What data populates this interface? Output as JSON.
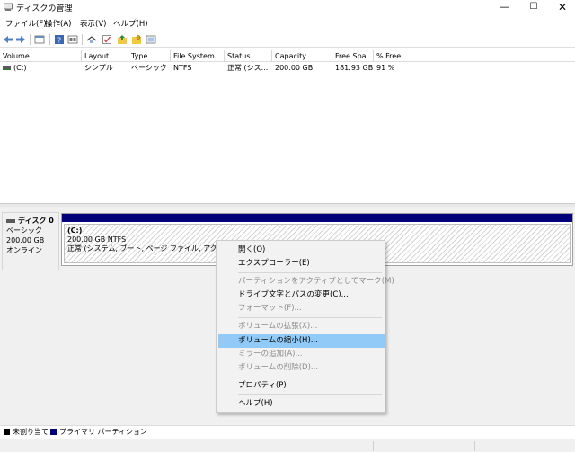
{
  "window": {
    "title": "ディスクの管理",
    "min": "—",
    "max": "☐",
    "close": "✕"
  },
  "menu": [
    "ファイル(F)",
    "操作(A)",
    "表示(V)",
    "ヘルプ(H)"
  ],
  "toolbar_icons": [
    "back-arrow-icon",
    "forward-arrow-icon",
    "disk-list-icon",
    "help-icon",
    "properties-icon",
    "connect-icon",
    "check-icon",
    "up-folder-icon",
    "folder-key-icon",
    "view-icon"
  ],
  "columns": [
    "Volume",
    "Layout",
    "Type",
    "File System",
    "Status",
    "Capacity",
    "Free Spa...",
    "% Free"
  ],
  "rows": [
    {
      "volume": "(C:)",
      "layout": "シンプル",
      "type": "ベーシック",
      "fs": "NTFS",
      "status": "正常 (シス...",
      "capacity": "200.00 GB",
      "free": "181.93 GB",
      "pct": "91 %"
    }
  ],
  "disk": {
    "name": "ディスク 0",
    "type": "ベーシック",
    "size": "200.00 GB",
    "state": "オンライン"
  },
  "partition": {
    "name": "(C:)",
    "size_fs": "200.00 GB NTFS",
    "status": "正常 (システム, ブート, ページ ファイル, アクティブ, クラ"
  },
  "context_menu": [
    {
      "label": "開く(O)",
      "enabled": true
    },
    {
      "label": "エクスプローラー(E)",
      "enabled": true
    },
    {
      "label": "パーティションをアクティブとしてマーク(M)",
      "enabled": false
    },
    {
      "label": "ドライブ文字とパスの変更(C)...",
      "enabled": true
    },
    {
      "label": "フォーマット(F)...",
      "enabled": false
    },
    {
      "label": "ボリュームの拡張(X)...",
      "enabled": false
    },
    {
      "label": "ボリュームの縮小(H)...",
      "enabled": true,
      "highlighted": true
    },
    {
      "label": "ミラーの追加(A)...",
      "enabled": false
    },
    {
      "label": "ボリュームの削除(D)...",
      "enabled": false
    },
    {
      "label": "プロパティ(P)",
      "enabled": true
    },
    {
      "label": "ヘルプ(H)",
      "enabled": true
    }
  ],
  "legend": [
    {
      "label": "未割り当て",
      "color": "#000000"
    },
    {
      "label": "プライマリ パーティション",
      "color": "#00007a"
    }
  ],
  "colors": {
    "partition_bar": "#00007a",
    "highlight": "#91c9f7"
  }
}
